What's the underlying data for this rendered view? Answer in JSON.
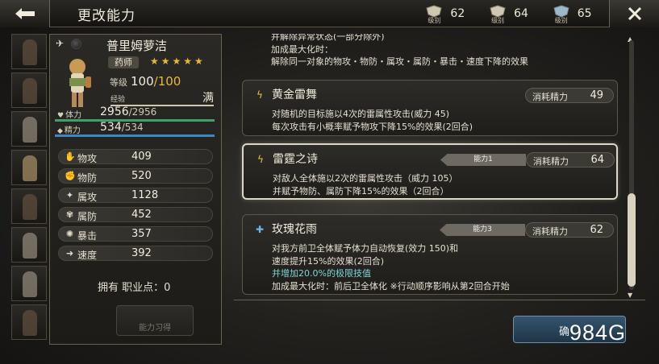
{
  "header": {
    "title": "更改能力",
    "levels": [
      {
        "caption": "级别",
        "value": "62"
      },
      {
        "caption": "级别",
        "value": "64"
      },
      {
        "caption": "级别",
        "value": "65"
      }
    ]
  },
  "character": {
    "name": "普里姆萝洁",
    "job": "药师",
    "stars": "★★★★★",
    "level_label": "等级",
    "level": "100",
    "level_max": "/100",
    "exp_label": "经验",
    "exp_status": "满",
    "hp_label": "体力",
    "hp_current": "2956",
    "hp_max": "/2956",
    "sp_label": "精力",
    "sp_current": "534",
    "sp_max": "/534",
    "stats": [
      {
        "label": "物攻",
        "value": "409"
      },
      {
        "label": "物防",
        "value": "520"
      },
      {
        "label": "属攻",
        "value": "1128"
      },
      {
        "label": "属防",
        "value": "452"
      },
      {
        "label": "暴击",
        "value": "357"
      },
      {
        "label": "速度",
        "value": "392"
      }
    ],
    "job_points": "拥有 职业点：0",
    "learn_button": "能力习得"
  },
  "abilities": {
    "prev_desc": [
      "并解除异常状态(一部分除外)",
      "加成最大化时：",
      "解除同一对象的物攻・物防・属攻・属防・暴击・速度下降的效果"
    ],
    "items": [
      {
        "name": "黄金雷舞",
        "tag": "",
        "cost_label": "消耗精力",
        "cost": "49",
        "desc": [
          "对随机的目标施以4次的雷属性攻击(威力 45)",
          "每次攻击有小概率赋予物攻下降15%的效果(2回合)"
        ]
      },
      {
        "name": "雷霆之诗",
        "tag": "能力1",
        "cost_label": "消耗精力",
        "cost": "64",
        "desc": [
          "对敌人全体施以2次的雷属性攻击（威力 105）",
          "并赋予物防、属防下降15%的效果（2回合）"
        ]
      },
      {
        "name": "玫瑰花雨",
        "tag": "能力3",
        "cost_label": "消耗精力",
        "cost": "62",
        "desc": [
          "对我方前卫全体赋予体力自动恢复(效力 150)和",
          "速度提升15%的效果(2回合)",
          "并增加20.0%的极限技值",
          "加成最大化时：前后卫全体化 ※行动顺序影响从第2回合开始"
        ]
      }
    ]
  },
  "footer": {
    "confirm_label": "确",
    "watermark": "984G"
  }
}
